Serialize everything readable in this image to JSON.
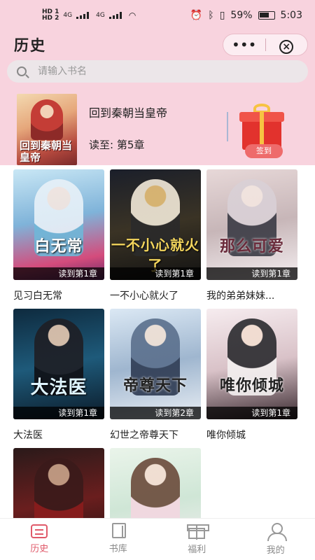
{
  "status_bar": {
    "hd1": "HD 1",
    "hd2": "HD 2",
    "network": "4G",
    "battery": "59%",
    "time": "5:03"
  },
  "header": {
    "title": "历史",
    "more_icon": "more-dots-icon",
    "close_icon": "close-circle-icon"
  },
  "search": {
    "placeholder": "请输入书名"
  },
  "recent": {
    "cover_text": "回到秦朝当皇帝",
    "title": "回到秦朝当皇帝",
    "progress": "读至: 第5章",
    "checkin_label": "签到"
  },
  "books": [
    {
      "name": "见习白无常",
      "cover_text": "白无常",
      "progress": "读到第1章"
    },
    {
      "name": "一不小心就火了",
      "cover_text": "一不小心就火了",
      "progress": "读到第1章"
    },
    {
      "name": "我的弟弟妹妹...",
      "cover_text": "那么可爱",
      "progress": "读到第1章"
    },
    {
      "name": "大法医",
      "cover_text": "大法医",
      "progress": "读到第1章"
    },
    {
      "name": "幻世之帝尊天下",
      "cover_text": "帝尊天下",
      "progress": "读到第2章"
    },
    {
      "name": "唯你倾城",
      "cover_text": "唯你倾城",
      "progress": "读到第1章"
    },
    {
      "name": "",
      "cover_text": "",
      "progress": ""
    },
    {
      "name": "",
      "cover_text": "",
      "progress": ""
    }
  ],
  "tabs": [
    {
      "label": "历史",
      "icon": "history-icon",
      "active": true
    },
    {
      "label": "书库",
      "icon": "bookshelf-icon",
      "active": false
    },
    {
      "label": "福利",
      "icon": "gift-icon",
      "active": false
    },
    {
      "label": "我的",
      "icon": "profile-icon",
      "active": false
    }
  ],
  "colors": {
    "header_bg": "#f8d3de",
    "accent": "#e05a6a",
    "checkin": "#ee6b6b"
  }
}
